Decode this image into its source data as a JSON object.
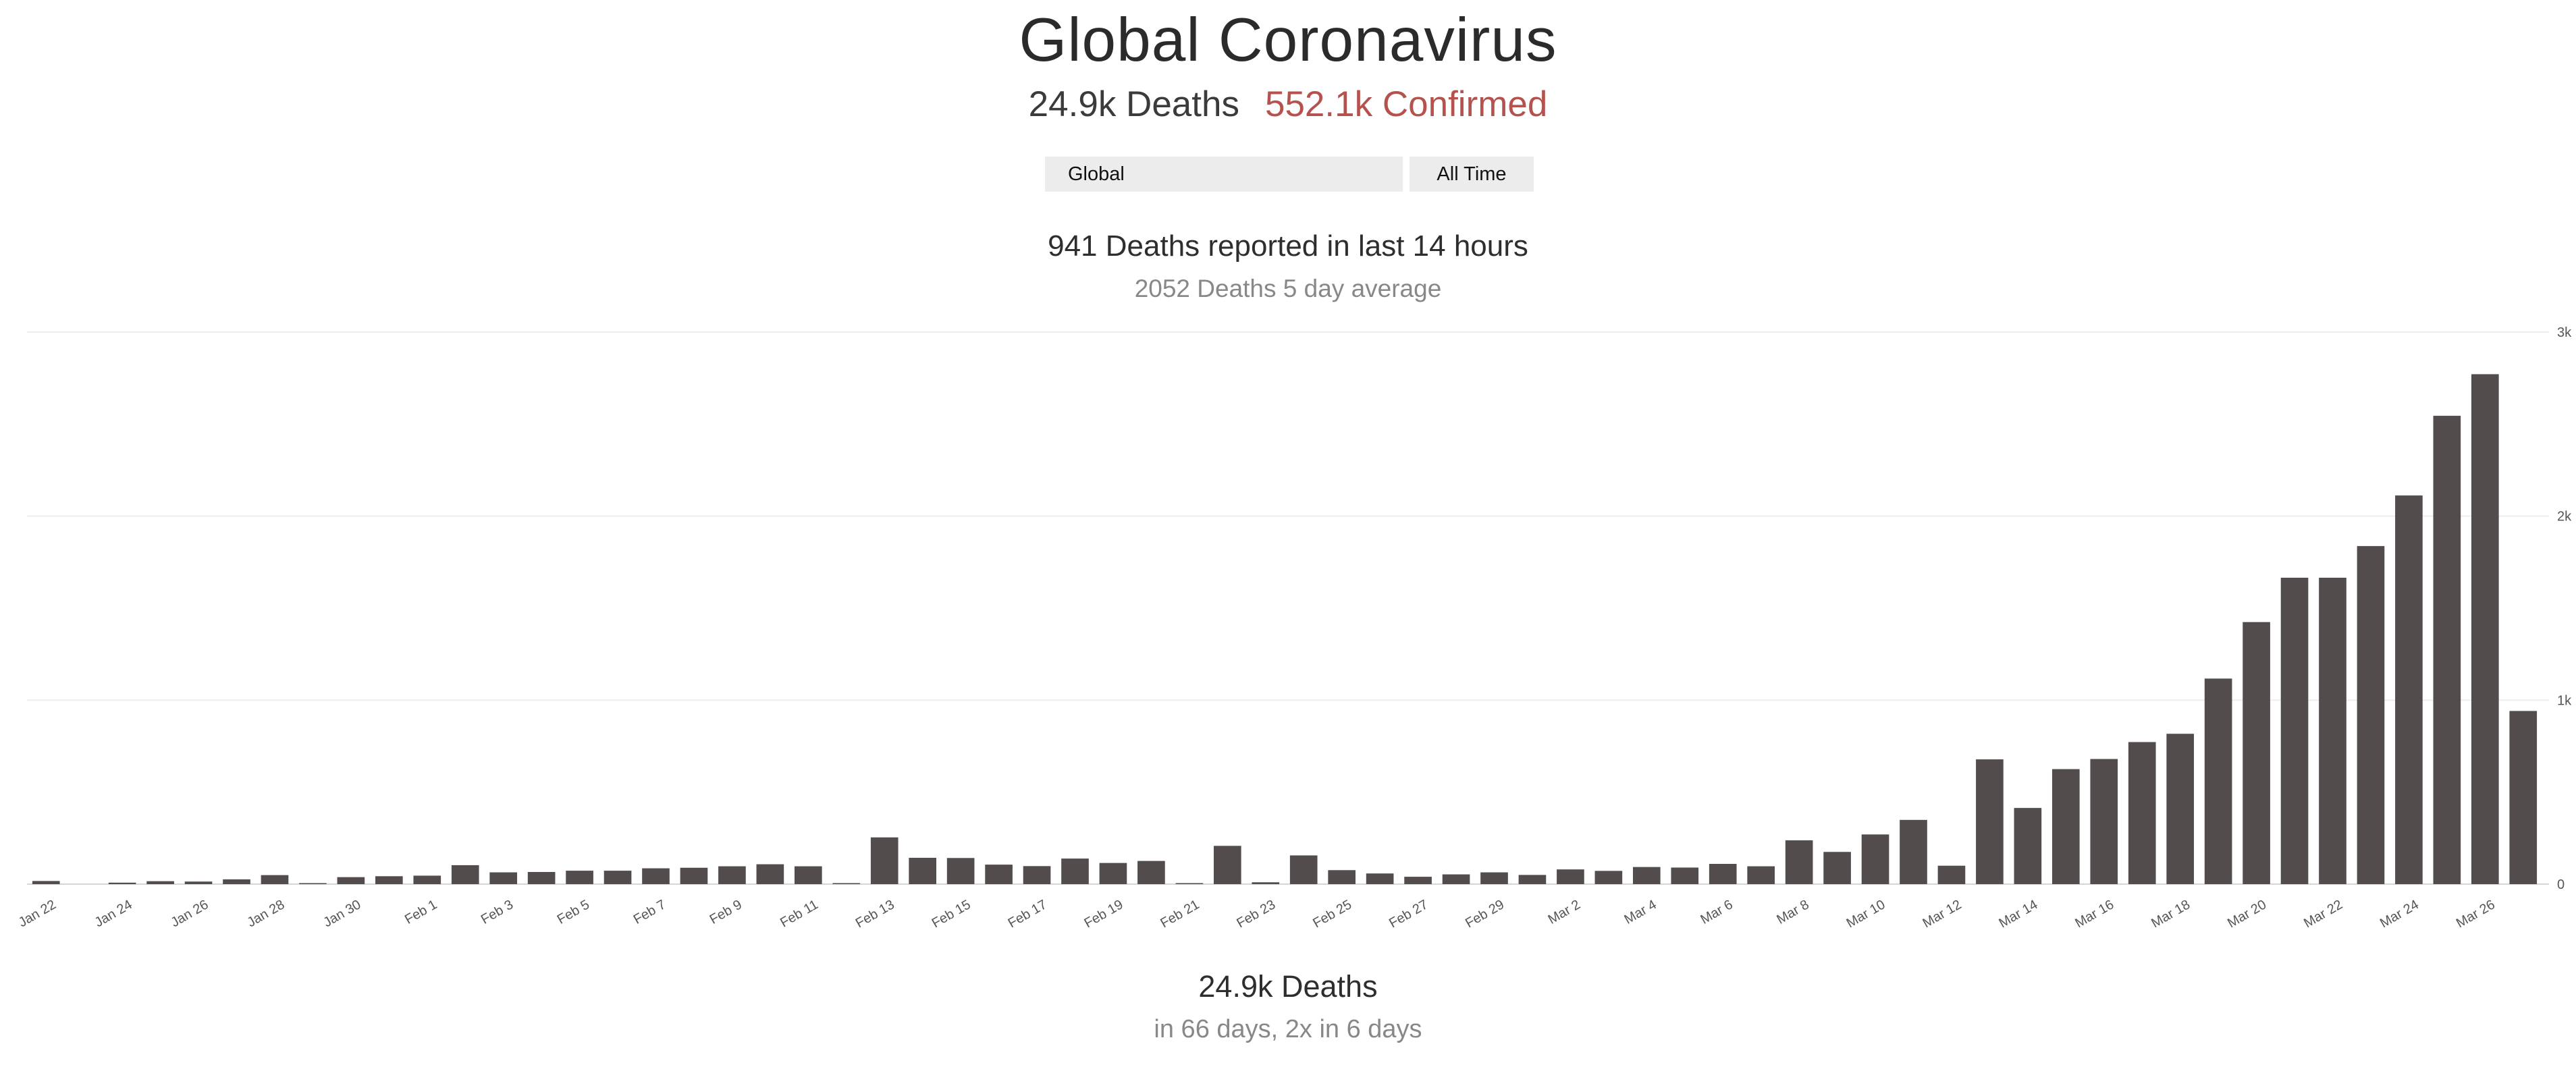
{
  "header": {
    "title": "Global Coronavirus",
    "deaths": "24.9k Deaths",
    "confirmed": "552.1k Confirmed",
    "confirmed_color": "#b5524d"
  },
  "controls": {
    "region": "Global",
    "period": "All Time"
  },
  "stats": {
    "recent": "941 Deaths reported in last 14 hours",
    "average": "2052 Deaths 5 day average"
  },
  "footer": {
    "total": "24.9k Deaths",
    "growth": "in 66 days, 2x in 6 days"
  },
  "chart_data": {
    "type": "bar",
    "bar_color": "#524c4c",
    "grid": true,
    "y_axis_side": "right",
    "ylim": [
      0,
      3000
    ],
    "yticks": [
      0,
      1000,
      2000,
      3000
    ],
    "ytick_labels": [
      "0",
      "1k",
      "2k",
      "3k"
    ],
    "categories": [
      "Jan 22",
      "Jan 23",
      "Jan 24",
      "Jan 25",
      "Jan 26",
      "Jan 27",
      "Jan 28",
      "Jan 29",
      "Jan 30",
      "Jan 31",
      "Feb 1",
      "Feb 2",
      "Feb 3",
      "Feb 4",
      "Feb 5",
      "Feb 6",
      "Feb 7",
      "Feb 8",
      "Feb 9",
      "Feb 10",
      "Feb 11",
      "Feb 12",
      "Feb 13",
      "Feb 14",
      "Feb 15",
      "Feb 16",
      "Feb 17",
      "Feb 18",
      "Feb 19",
      "Feb 20",
      "Feb 21",
      "Feb 22",
      "Feb 23",
      "Feb 24",
      "Feb 25",
      "Feb 26",
      "Feb 27",
      "Feb 28",
      "Feb 29",
      "Mar 1",
      "Mar 2",
      "Mar 3",
      "Mar 4",
      "Mar 5",
      "Mar 6",
      "Mar 7",
      "Mar 8",
      "Mar 9",
      "Mar 10",
      "Mar 11",
      "Mar 12",
      "Mar 13",
      "Mar 14",
      "Mar 15",
      "Mar 16",
      "Mar 17",
      "Mar 18",
      "Mar 19",
      "Mar 20",
      "Mar 21",
      "Mar 22",
      "Mar 23",
      "Mar 24",
      "Mar 25",
      "Mar 26",
      "Mar 27"
    ],
    "values": [
      17,
      0,
      8,
      16,
      14,
      26,
      49,
      2,
      38,
      43,
      46,
      103,
      64,
      66,
      73,
      73,
      86,
      89,
      97,
      108,
      97,
      5,
      254,
      143,
      142,
      106,
      98,
      139,
      115,
      126,
      2,
      208,
      10,
      156,
      76,
      58,
      40,
      53,
      64,
      50,
      80,
      72,
      93,
      90,
      110,
      97,
      238,
      175,
      270,
      349,
      100,
      678,
      414,
      625,
      680,
      772,
      817,
      1117,
      1424,
      1665,
      1665,
      1837,
      2112,
      2545,
      2771,
      941
    ],
    "tick_labels": [
      "Jan 22",
      "Jan 24",
      "Jan 26",
      "Jan 28",
      "Jan 30",
      "Feb 1",
      "Feb 3",
      "Feb 5",
      "Feb 7",
      "Feb 9",
      "Feb 11",
      "Feb 13",
      "Feb 15",
      "Feb 17",
      "Feb 19",
      "Feb 21",
      "Feb 23",
      "Feb 25",
      "Feb 27",
      "Feb 29",
      "Mar 2",
      "Mar 4",
      "Mar 6",
      "Mar 8",
      "Mar 10",
      "Mar 12",
      "Mar 14",
      "Mar 16",
      "Mar 18",
      "Mar 20",
      "Mar 22",
      "Mar 24",
      "Mar 26"
    ]
  }
}
